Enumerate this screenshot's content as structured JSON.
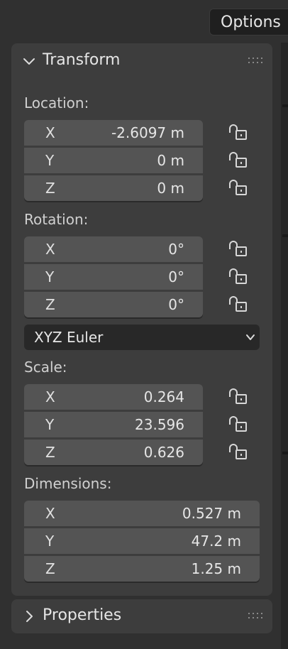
{
  "header": {
    "options_label": "Options"
  },
  "transform_panel": {
    "title": "Transform",
    "location": {
      "label": "Location:",
      "fields": [
        {
          "axis": "X",
          "value": "-2.6097 m"
        },
        {
          "axis": "Y",
          "value": "0 m"
        },
        {
          "axis": "Z",
          "value": "0 m"
        }
      ]
    },
    "rotation": {
      "label": "Rotation:",
      "fields": [
        {
          "axis": "X",
          "value": "0°"
        },
        {
          "axis": "Y",
          "value": "0°"
        },
        {
          "axis": "Z",
          "value": "0°"
        }
      ],
      "mode": "XYZ Euler"
    },
    "scale": {
      "label": "Scale:",
      "fields": [
        {
          "axis": "X",
          "value": "0.264"
        },
        {
          "axis": "Y",
          "value": "23.596"
        },
        {
          "axis": "Z",
          "value": "0.626"
        }
      ]
    },
    "dimensions": {
      "label": "Dimensions:",
      "fields": [
        {
          "axis": "X",
          "value": "0.527 m"
        },
        {
          "axis": "Y",
          "value": "47.2 m"
        },
        {
          "axis": "Z",
          "value": "1.25 m"
        }
      ]
    }
  },
  "properties_panel": {
    "title": "Properties"
  },
  "icons": {
    "expanded": "chevron-down-icon",
    "collapsed": "chevron-right-icon",
    "lock": "unlocked-padlock-icon",
    "grip": "drag-grip-icon",
    "dropdown": "chevron-down-icon"
  },
  "colors": {
    "background": "#303030",
    "panel": "#3d3d3d",
    "field": "#545454",
    "dropdown": "#282828",
    "text": "#e6e6e6"
  }
}
